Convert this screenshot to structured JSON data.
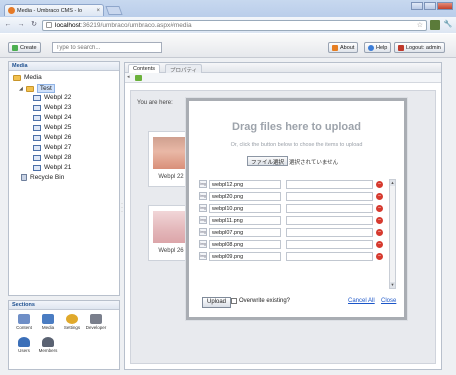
{
  "browser": {
    "tab_title": "Media - Umbraco CMS - lo",
    "tab_close": "×",
    "back": "←",
    "forward": "→",
    "reload": "↻",
    "url_host": "localhost",
    "url_path": ":36219/umbraco/umbraco.aspx#media",
    "star": "☆"
  },
  "header": {
    "create_label": "Create",
    "search_placeholder": "Type to search...",
    "about_label": "About",
    "help_label": "Help",
    "logout_label": "Logout: admin"
  },
  "tree": {
    "panel_title": "Media",
    "root": "Media",
    "folder": "Test",
    "items": [
      "Webpl 22",
      "Webpl 23",
      "Webpl 24",
      "Webpl 25",
      "Webpl 26",
      "Webpl 27",
      "Webpl 28",
      "Webpl 21"
    ],
    "recycle_bin": "Recycle Bin"
  },
  "sections": {
    "title": "Sections",
    "items": [
      {
        "label": "Content",
        "color": "#6f8fc7"
      },
      {
        "label": "Media",
        "color": "#4a7cc2"
      },
      {
        "label": "Settings",
        "color": "#e0a92b"
      },
      {
        "label": "Developer",
        "color": "#7a7f8c"
      },
      {
        "label": "Users",
        "color": "#3b6fb8"
      },
      {
        "label": "Members",
        "color": "#5a6272"
      }
    ]
  },
  "main": {
    "tabs": [
      "Contents",
      "プロパティ"
    ],
    "you_are_here": "You are here:",
    "thumbs": [
      {
        "caption": "Webpl 22",
        "color": "#d99a86"
      },
      {
        "caption": "Webpl 26",
        "color": "#e3b6b9"
      }
    ]
  },
  "upload": {
    "title": "Drag files here to upload",
    "subtitle": "Or, click the button below to chose the items to upload",
    "choose_button": "ファイル選択",
    "choose_note": "選択されていません",
    "files": [
      "webpl12.png",
      "webpl20.png",
      "webpl10.png",
      "webpl11.png",
      "webpl07.png",
      "webpl08.png",
      "webpl09.png"
    ],
    "upload_button": "Upload",
    "overwrite_label": "Overwrite existing?",
    "cancel_all": "Cancel All",
    "close": "Close"
  },
  "colors": {
    "accent": "#1a55c8",
    "delete": "#d63a2f",
    "logout": "#c0392b"
  }
}
